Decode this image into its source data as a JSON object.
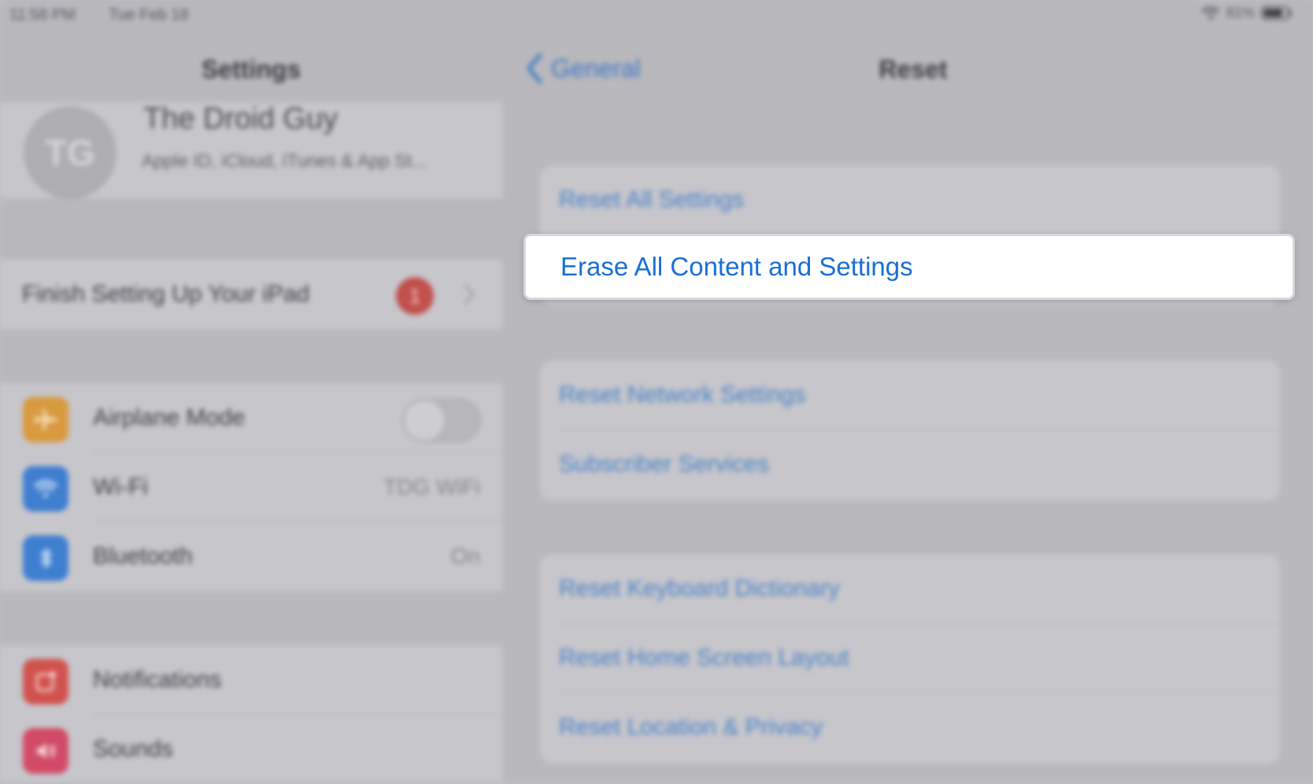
{
  "status_bar": {
    "time": "11:58 PM",
    "date": "Tue Feb 18",
    "battery": "81%",
    "battery_level": 0.81
  },
  "sidebar": {
    "title": "Settings",
    "profile": {
      "initials": "TG",
      "name": "The Droid Guy",
      "subtitle": "Apple ID, iCloud, iTunes & App St..."
    },
    "finish_setup": {
      "label": "Finish Setting Up Your iPad",
      "badge": "1"
    },
    "connectivity": [
      {
        "label": "Airplane Mode",
        "value": "",
        "icon": "airplane-icon",
        "color": "#d99a3f"
      },
      {
        "label": "Wi-Fi",
        "value": "TDG WiFi",
        "icon": "wifi-icon",
        "color": "#3f7fd0"
      },
      {
        "label": "Bluetooth",
        "value": "On",
        "icon": "bluetooth-icon",
        "color": "#3f7fd0"
      }
    ],
    "system": [
      {
        "label": "Notifications",
        "icon": "notifications-icon",
        "color": "#d1524d"
      },
      {
        "label": "Sounds",
        "icon": "sounds-icon",
        "color": "#d24a66"
      }
    ]
  },
  "detail": {
    "back_label": "General",
    "title": "Reset",
    "group1": [
      "Reset All Settings",
      "Erase All Content and Settings"
    ],
    "group2": [
      "Reset Network Settings",
      "Subscriber Services"
    ],
    "group3": [
      "Reset Keyboard Dictionary",
      "Reset Home Screen Layout",
      "Reset Location & Privacy"
    ]
  }
}
